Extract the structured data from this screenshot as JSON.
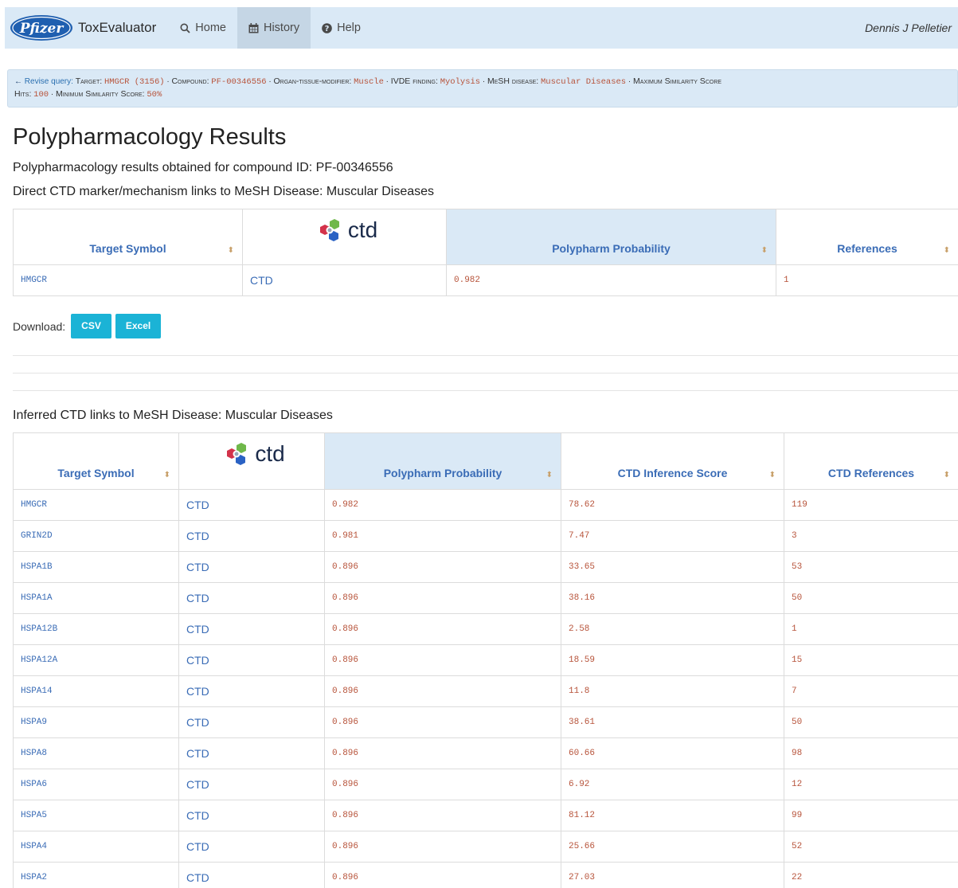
{
  "nav": {
    "brand_logo_text": "Pfizer",
    "app_name": "ToxEvaluator",
    "home": "Home",
    "history": "History",
    "help": "Help",
    "user": "Dennis J Pelletier"
  },
  "query": {
    "revise": "Revise query:",
    "target_label": "Target:",
    "target_value": "HMGCR (3156)",
    "compound_label": "Compound:",
    "compound_value": "PF-00346556",
    "organ_label": "Organ-tissue-modifier:",
    "organ_value": "Muscle",
    "ivde_label": "IVDE finding:",
    "ivde_value": "Myolysis",
    "mesh_label": "MeSH disease:",
    "mesh_value": "Muscular Diseases",
    "maxsim_label": "Maximum Similarity Score",
    "hits_label": "Hits:",
    "hits_value": "100",
    "minsim_label": "Minimum Similarity Score:",
    "minsim_value": "50%"
  },
  "page": {
    "title": "Polypharmacology Results",
    "subtitle": "Polypharmacology results obtained for compound ID: PF-00346556",
    "direct_heading": "Direct CTD marker/mechanism links to MeSH Disease: Muscular Diseases",
    "inferred_heading": "Inferred CTD links to MeSH Disease: Muscular Diseases"
  },
  "logo": {
    "ctd_text": "ctd"
  },
  "direct_table": {
    "headers": [
      "Target Symbol",
      "Polypharm Probability",
      "References"
    ],
    "rows": [
      {
        "symbol": "HMGCR",
        "ctd": "CTD",
        "prob": "0.982",
        "refs": "1"
      }
    ]
  },
  "download": {
    "label": "Download:",
    "csv": "CSV",
    "excel": "Excel"
  },
  "sort_glyph": "⬍",
  "inferred_table": {
    "headers": [
      "Target Symbol",
      "Polypharm Probability",
      "CTD Inference Score",
      "CTD References"
    ],
    "rows": [
      {
        "symbol": "HMGCR",
        "ctd": "CTD",
        "prob": "0.982",
        "score": "78.62",
        "refs": "119"
      },
      {
        "symbol": "GRIN2D",
        "ctd": "CTD",
        "prob": "0.981",
        "score": "7.47",
        "refs": "3"
      },
      {
        "symbol": "HSPA1B",
        "ctd": "CTD",
        "prob": "0.896",
        "score": "33.65",
        "refs": "53"
      },
      {
        "symbol": "HSPA1A",
        "ctd": "CTD",
        "prob": "0.896",
        "score": "38.16",
        "refs": "50"
      },
      {
        "symbol": "HSPA12B",
        "ctd": "CTD",
        "prob": "0.896",
        "score": "2.58",
        "refs": "1"
      },
      {
        "symbol": "HSPA12A",
        "ctd": "CTD",
        "prob": "0.896",
        "score": "18.59",
        "refs": "15"
      },
      {
        "symbol": "HSPA14",
        "ctd": "CTD",
        "prob": "0.896",
        "score": "11.8",
        "refs": "7"
      },
      {
        "symbol": "HSPA9",
        "ctd": "CTD",
        "prob": "0.896",
        "score": "38.61",
        "refs": "50"
      },
      {
        "symbol": "HSPA8",
        "ctd": "CTD",
        "prob": "0.896",
        "score": "60.66",
        "refs": "98"
      },
      {
        "symbol": "HSPA6",
        "ctd": "CTD",
        "prob": "0.896",
        "score": "6.92",
        "refs": "12"
      },
      {
        "symbol": "HSPA5",
        "ctd": "CTD",
        "prob": "0.896",
        "score": "81.12",
        "refs": "99"
      },
      {
        "symbol": "HSPA4",
        "ctd": "CTD",
        "prob": "0.896",
        "score": "25.66",
        "refs": "52"
      },
      {
        "symbol": "HSPA2",
        "ctd": "CTD",
        "prob": "0.896",
        "score": "27.03",
        "refs": "22"
      }
    ]
  },
  "colors": {
    "nav_bg": "#dae9f6",
    "link_blue": "#3a6cb6",
    "mono_value": "#b7533a",
    "button": "#1bb3d6"
  }
}
